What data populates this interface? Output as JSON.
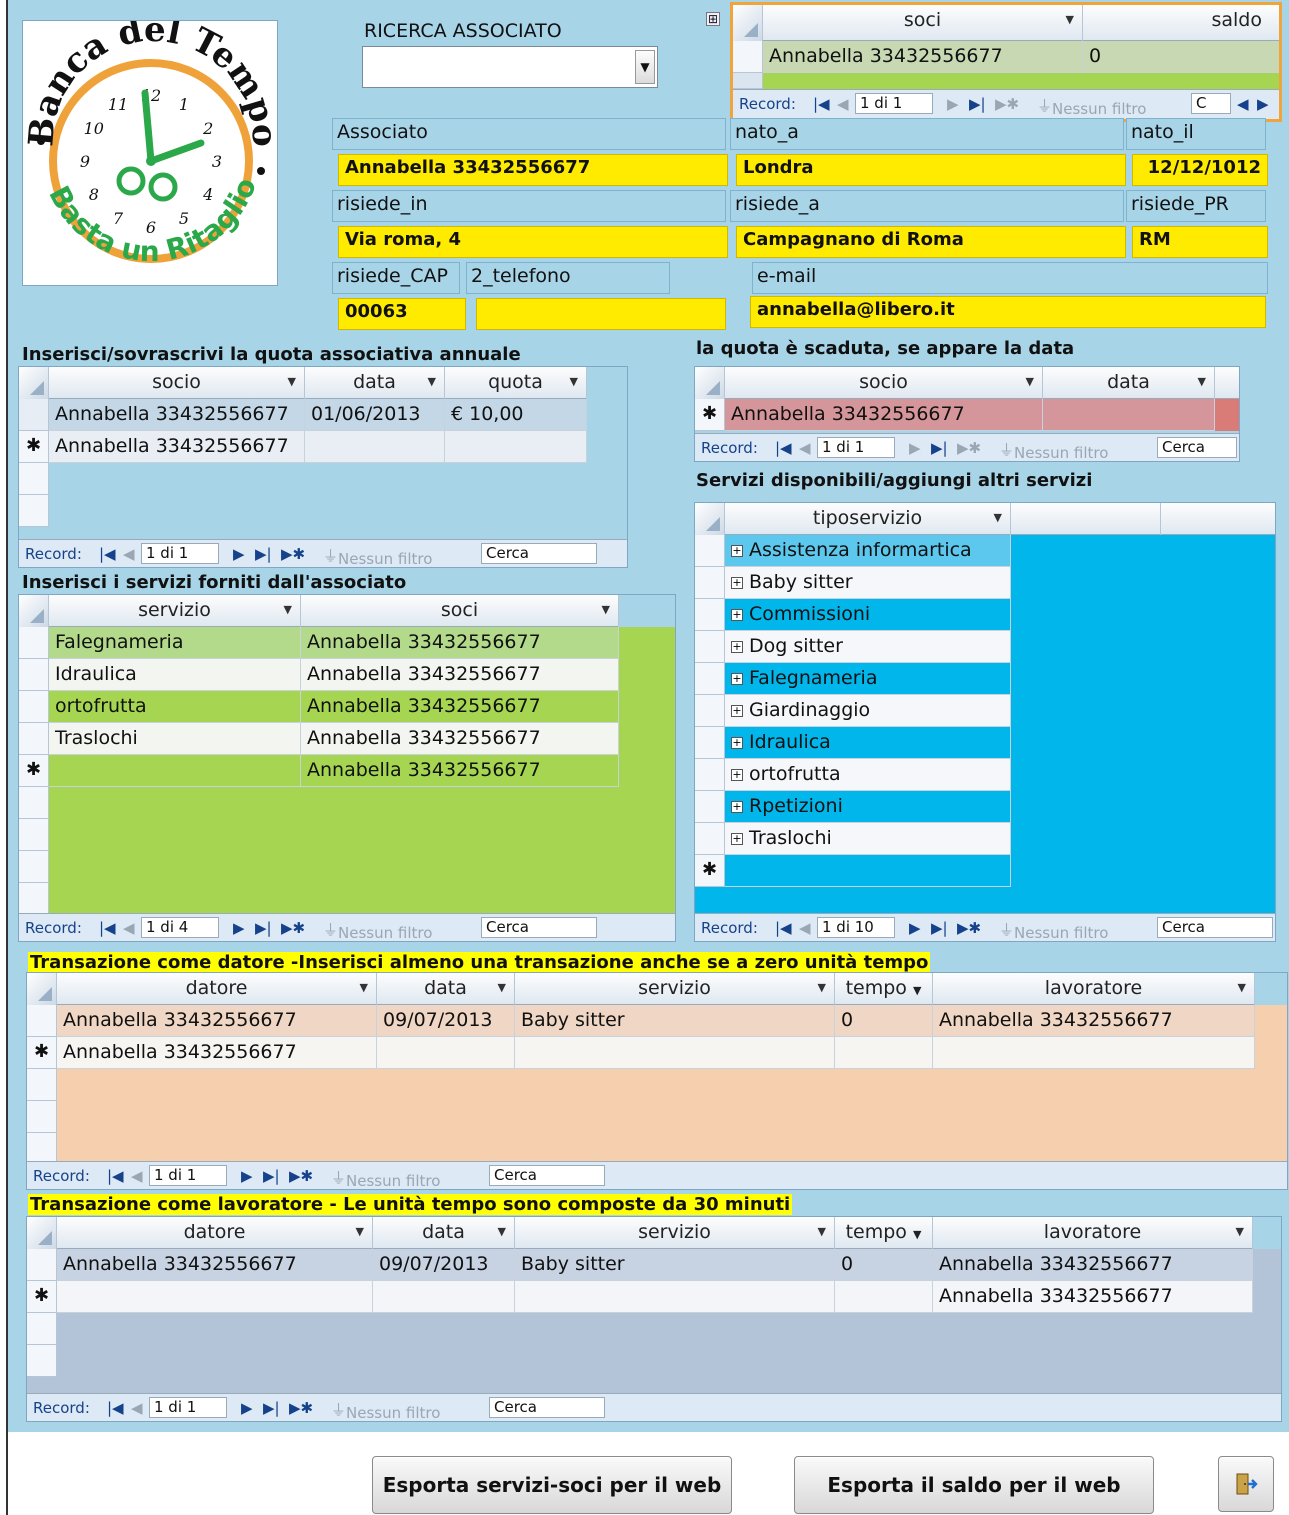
{
  "search": {
    "label": "RICERCA ASSOCIATO",
    "value": ""
  },
  "logo": {
    "top_text": "Banca del Tempo",
    "bottom_text": "Basta un Ritaglio",
    "numbers": [
      "12",
      "1",
      "2",
      "3",
      "4",
      "5",
      "6",
      "7",
      "8",
      "9",
      "10",
      "11"
    ]
  },
  "soci_saldo": {
    "headers": [
      "soci",
      "saldo"
    ],
    "row": {
      "soci": "Annabella 33432556677",
      "saldo": "0"
    },
    "nav": {
      "record_label": "Record:",
      "position": "1 di 1",
      "filter": "Nessun filtro",
      "search": "C"
    }
  },
  "fields": {
    "associato": {
      "label": "Associato",
      "value": "Annabella 33432556677"
    },
    "nato_a": {
      "label": "nato_a",
      "value": "Londra"
    },
    "nato_il": {
      "label": "nato_il",
      "value": "12/12/1012"
    },
    "risiede_in": {
      "label": "risiede_in",
      "value": "Via roma, 4"
    },
    "risiede_a": {
      "label": "risiede_a",
      "value": "Campagnano di Roma"
    },
    "risiede_pr": {
      "label": "risiede_PR",
      "value": "RM"
    },
    "risiede_cap": {
      "label": "risiede_CAP",
      "value": "00063"
    },
    "telefono": {
      "label": "2_telefono",
      "value": ""
    },
    "email": {
      "label": "e-mail",
      "value": "annabella@libero.it"
    }
  },
  "quota": {
    "title": "Inserisci/sovrascrivi la quota associativa annuale",
    "headers": [
      "socio",
      "data",
      "quota"
    ],
    "rows": [
      {
        "socio": "Annabella 33432556677",
        "data": "01/06/2013",
        "quota": "€ 10,00"
      },
      {
        "socio": "Annabella 33432556677",
        "data": "",
        "quota": ""
      }
    ],
    "nav": {
      "record_label": "Record:",
      "position": "1 di 1",
      "filter": "Nessun filtro",
      "search": "Cerca"
    }
  },
  "scaduta": {
    "title": "la quota è scaduta, se appare la data",
    "headers": [
      "socio",
      "data"
    ],
    "rows": [
      {
        "socio": "Annabella 33432556677",
        "data": ""
      }
    ],
    "nav": {
      "record_label": "Record:",
      "position": "1 di 1",
      "filter": "Nessun filtro",
      "search": "Cerca"
    }
  },
  "servizi_forniti": {
    "title": "Inserisci i servizi forniti dall'associato",
    "headers": [
      "servizio",
      "soci"
    ],
    "rows": [
      {
        "servizio": "Falegnameria",
        "soci": "Annabella 33432556677"
      },
      {
        "servizio": "Idraulica",
        "soci": "Annabella 33432556677"
      },
      {
        "servizio": "ortofrutta",
        "soci": "Annabella 33432556677"
      },
      {
        "servizio": "Traslochi",
        "soci": "Annabella 33432556677"
      },
      {
        "servizio": "",
        "soci": "Annabella 33432556677"
      }
    ],
    "nav": {
      "record_label": "Record:",
      "position": "1 di 4",
      "filter": "Nessun filtro",
      "search": "Cerca"
    }
  },
  "servizi_disponibili": {
    "title": "Servizi disponibili/aggiungi altri servizi",
    "headers": [
      "tiposervizio"
    ],
    "rows": [
      "Assistenza informartica",
      "Baby sitter",
      "Commissioni",
      "Dog sitter",
      "Falegnameria",
      "Giardinaggio",
      "Idraulica",
      "ortofrutta",
      "Rpetizioni",
      "Traslochi"
    ],
    "nav": {
      "record_label": "Record:",
      "position": "1 di 10",
      "filter": "Nessun filtro",
      "search": "Cerca"
    }
  },
  "datore": {
    "title": "Transazione come datore -Inserisci almeno una transazione anche se a zero unità tempo",
    "headers": [
      "datore",
      "data",
      "servizio",
      "tempo",
      "lavoratore"
    ],
    "rows": [
      {
        "datore": "Annabella 33432556677",
        "data": "09/07/2013",
        "servizio": "Baby sitter",
        "tempo": "0",
        "lavoratore": "Annabella 33432556677"
      },
      {
        "datore": "Annabella 33432556677",
        "data": "",
        "servizio": "",
        "tempo": "",
        "lavoratore": ""
      }
    ],
    "nav": {
      "record_label": "Record:",
      "position": "1 di 1",
      "filter": "Nessun filtro",
      "search": "Cerca"
    }
  },
  "lavoratore": {
    "title": "Transazione come lavoratore - Le unità tempo sono composte da 30 minuti",
    "headers": [
      "datore",
      "data",
      "servizio",
      "tempo",
      "lavoratore"
    ],
    "rows": [
      {
        "datore": "Annabella 33432556677",
        "data": "09/07/2013",
        "servizio": "Baby sitter",
        "tempo": "0",
        "lavoratore": "Annabella 33432556677"
      },
      {
        "datore": "",
        "data": "",
        "servizio": "",
        "tempo": "",
        "lavoratore": "Annabella 33432556677"
      }
    ],
    "nav": {
      "record_label": "Record:",
      "position": "1 di 1",
      "filter": "Nessun filtro",
      "search": "Cerca"
    }
  },
  "buttons": {
    "export_services": "Esporta servizi-soci per il web",
    "export_balance": "Esporta il saldo per il web",
    "exit_icon": "exit-door-icon"
  },
  "colors": {
    "form_bg": "#a8d4e8",
    "field_yellow": "#ffeb00",
    "green": "#a6d651",
    "peach": "#f5cfae",
    "cyan": "#00b6ea",
    "steel": "#b3c4d8",
    "pink": "#d4969a"
  }
}
